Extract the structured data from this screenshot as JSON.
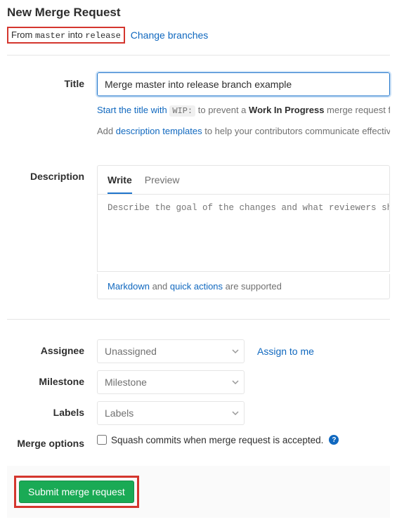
{
  "heading": "New Merge Request",
  "branch_info": {
    "prefix": "From ",
    "source": "master",
    "mid": " into ",
    "target": "release",
    "change_link": "Change branches"
  },
  "title_field": {
    "label": "Title",
    "value": "Merge master into release branch example",
    "hint_prefix": "Start the title with ",
    "wip_code": "WIP:",
    "hint_mid": " to prevent a ",
    "hint_bold": "Work In Progress",
    "hint_suffix": " merge request from be",
    "hint2_prefix": "Add ",
    "hint2_link": "description templates",
    "hint2_suffix": " to help your contributors communicate effectively!"
  },
  "description": {
    "label": "Description",
    "tabs": {
      "write": "Write",
      "preview": "Preview"
    },
    "placeholder": "Describe the goal of the changes and what reviewers should be ",
    "footer_link1": "Markdown",
    "footer_mid": " and ",
    "footer_link2": "quick actions",
    "footer_suffix": " are supported"
  },
  "assignee": {
    "label": "Assignee",
    "value": "Unassigned",
    "assign_link": "Assign to me"
  },
  "milestone": {
    "label": "Milestone",
    "value": "Milestone"
  },
  "labels": {
    "label": "Labels",
    "value": "Labels"
  },
  "merge_options": {
    "label": "Merge options",
    "squash_label": "Squash commits when merge request is accepted.",
    "help_glyph": "?"
  },
  "submit": {
    "label": "Submit merge request"
  }
}
